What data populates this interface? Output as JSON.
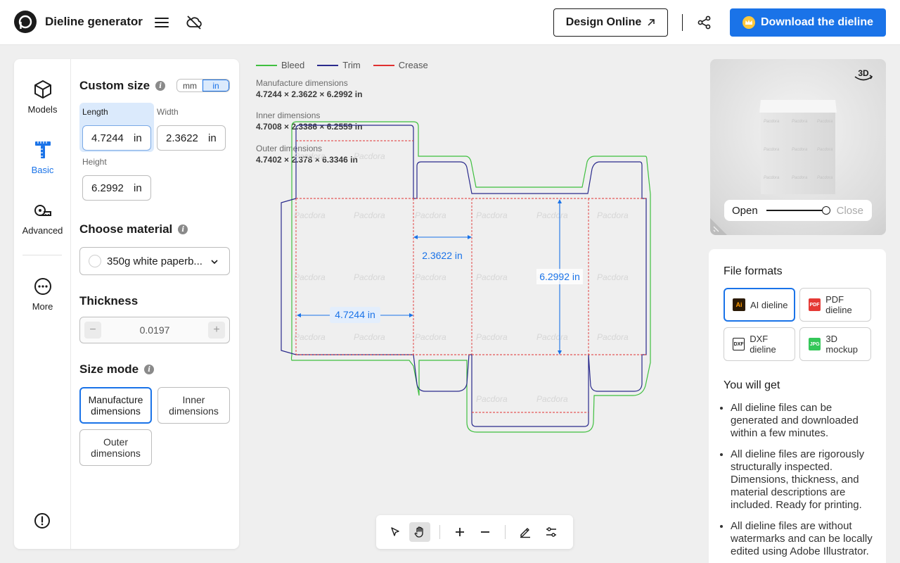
{
  "header": {
    "app_title": "Dieline generator",
    "design_online_label": "Design Online",
    "download_label": "Download the dieline"
  },
  "nav": {
    "items": [
      {
        "label": "Models"
      },
      {
        "label": "Basic"
      },
      {
        "label": "Advanced"
      },
      {
        "label": "More"
      }
    ]
  },
  "custom_size": {
    "title": "Custom size",
    "unit_mm": "mm",
    "unit_in": "in",
    "length": {
      "label": "Length",
      "value": "4.7244",
      "unit": "in"
    },
    "width": {
      "label": "Width",
      "value": "2.3622",
      "unit": "in"
    },
    "height": {
      "label": "Height",
      "value": "6.2992",
      "unit": "in"
    }
  },
  "material": {
    "title": "Choose material",
    "selected": "350g white paperb..."
  },
  "thickness": {
    "title": "Thickness",
    "value": "0.0197"
  },
  "size_mode": {
    "title": "Size mode",
    "manufacture": "Manufacture dimensions",
    "inner": "Inner dimensions",
    "outer": "Outer dimensions"
  },
  "legend": {
    "bleed": "Bleed",
    "trim": "Trim",
    "crease": "Crease",
    "colors": {
      "bleed": "#3fbf3f",
      "trim": "#2a2a8c",
      "crease": "#e03030"
    }
  },
  "dimensions": {
    "manufacture_label": "Manufacture dimensions",
    "manufacture_value": "4.7244 × 2.3622 × 6.2992 in",
    "inner_label": "Inner dimensions",
    "inner_value": "4.7008 × 2.3386 × 6.2559 in",
    "outer_label": "Outer dimensions",
    "outer_value": "4.7402 × 2.378 × 6.3346 in"
  },
  "dieline": {
    "length_label": "4.7244 in",
    "width_label": "2.3622 in",
    "height_label": "6.2992 in",
    "watermark": "Pacdora"
  },
  "preview": {
    "open_label": "Open",
    "close_label": "Close",
    "fold_level": 1.0
  },
  "file_formats": {
    "title": "File formats",
    "items": [
      {
        "label": "AI dieline",
        "icon_text": "Ai"
      },
      {
        "label": "PDF dieline",
        "icon_text": "PDF"
      },
      {
        "label": "DXF dieline",
        "icon_text": "DXF"
      },
      {
        "label": "3D mockup",
        "icon_text": "JPG"
      }
    ]
  },
  "you_will_get": {
    "title": "You will get",
    "items": [
      "All dieline files can be generated and downloaded within a few minutes.",
      "All dieline files are rigorously structurally inspected. Dimensions, thickness, and material descriptions are included. Ready for printing.",
      "All dieline files are without watermarks and can be locally edited using Adobe Illustrator."
    ]
  }
}
